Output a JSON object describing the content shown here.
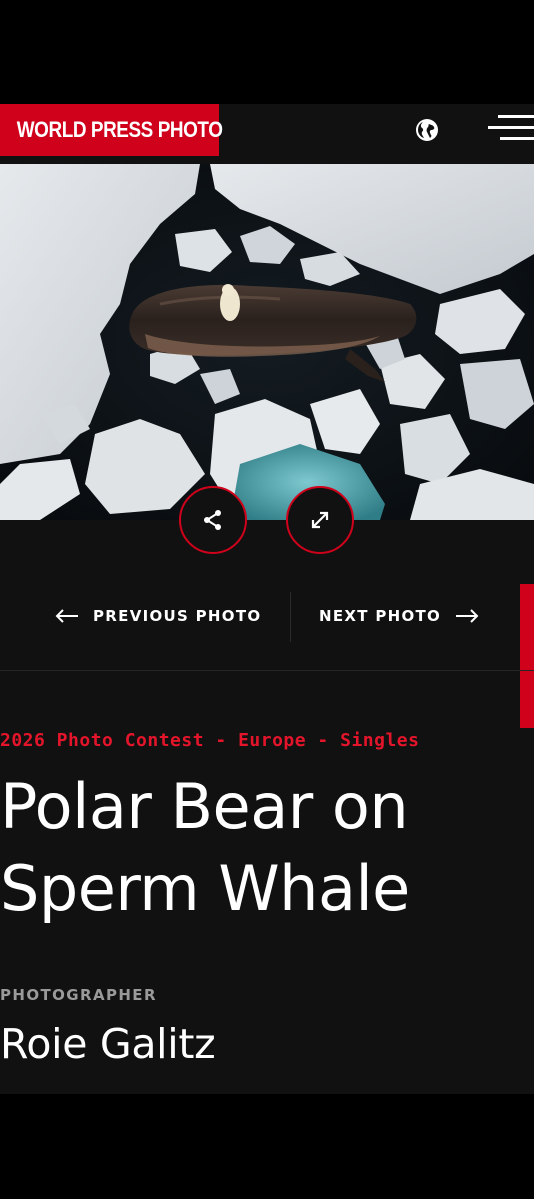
{
  "header": {
    "logo_text": "WORLD PRESS PHOTO",
    "language_icon": "globe-icon",
    "menu_icon": "hamburger-menu-icon"
  },
  "photo": {
    "share_icon": "share-icon",
    "expand_icon": "expand-icon"
  },
  "navigation": {
    "previous_label": "PREVIOUS PHOTO",
    "next_label": "NEXT PHOTO"
  },
  "content": {
    "category": "2026 Photo Contest - Europe - Singles",
    "title": "Polar Bear on Sperm Whale",
    "photographer_label": "PHOTOGRAPHER",
    "photographer_name": "Roie Galitz"
  },
  "colors": {
    "accent": "#d0021b",
    "background": "#111111",
    "text": "#ffffff",
    "muted": "#9a9a9a"
  }
}
